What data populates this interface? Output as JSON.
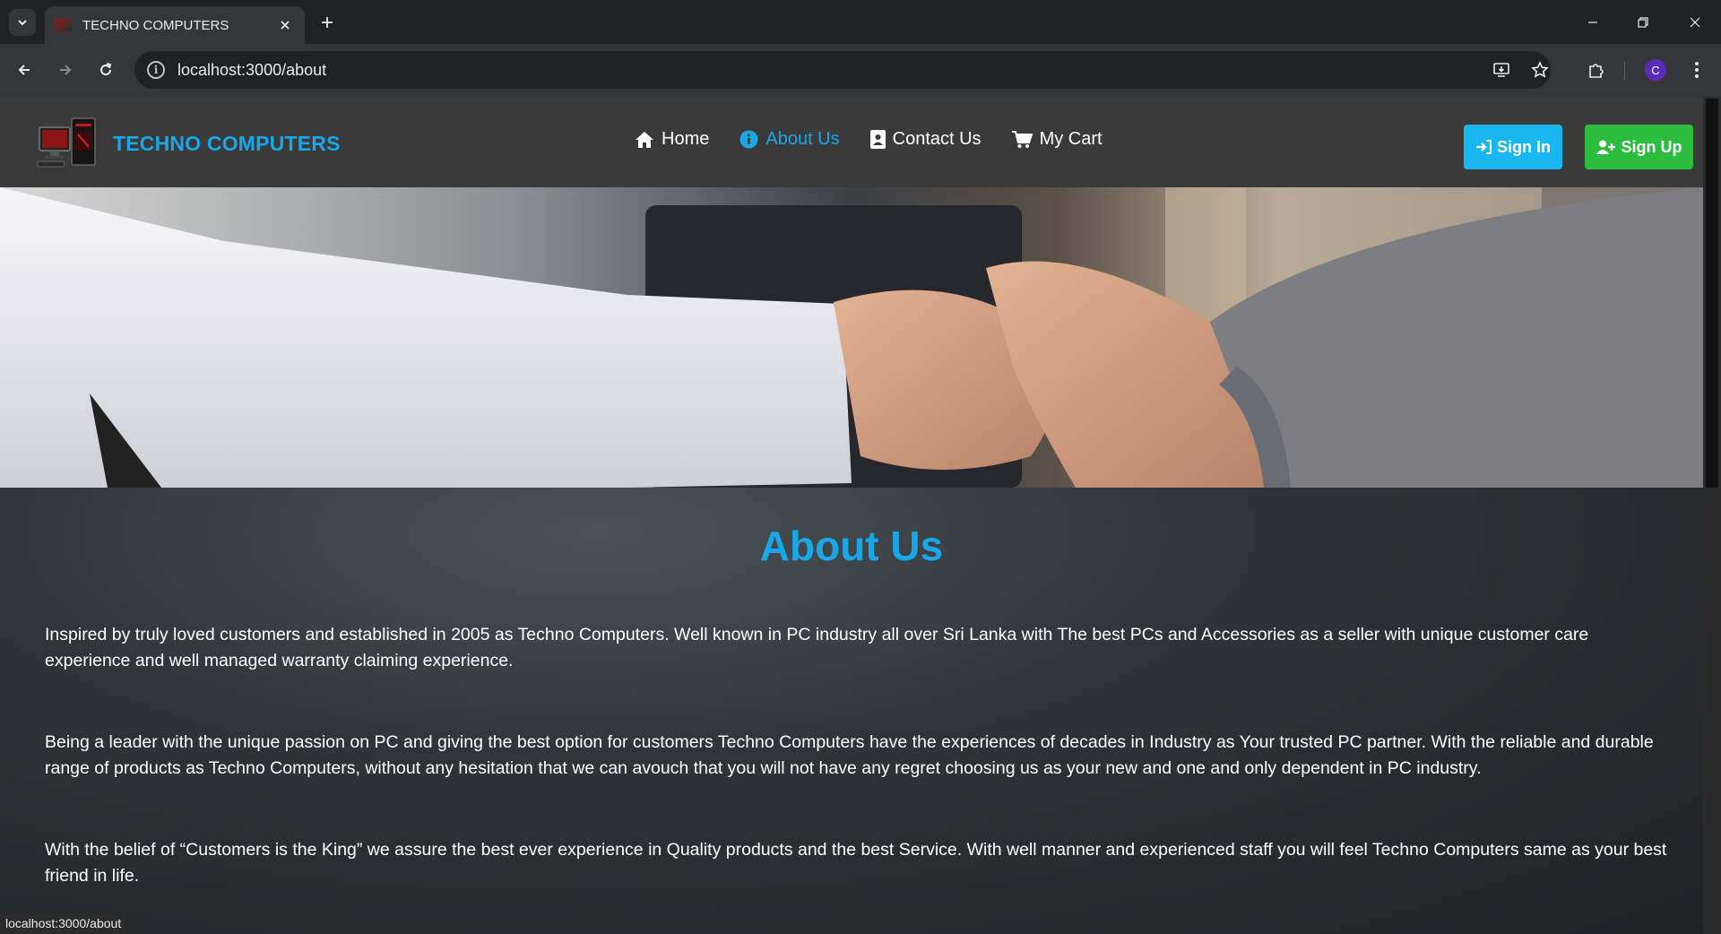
{
  "browser": {
    "tab_title": "TECHNO COMPUTERS",
    "url": "localhost:3000/about",
    "profile_initial": "C",
    "status_url": "localhost:3000/about"
  },
  "site": {
    "brand": "TECHNO COMPUTERS",
    "nav": [
      {
        "label": "Home",
        "icon": "home-icon"
      },
      {
        "label": "About Us",
        "icon": "info-icon",
        "active": true
      },
      {
        "label": "Contact Us",
        "icon": "contact-card-icon"
      },
      {
        "label": "My Cart",
        "icon": "cart-icon"
      }
    ],
    "sign_in": "Sign In",
    "sign_up": "Sign Up",
    "colors": {
      "accent": "#1aa7e8",
      "signin": "#1ab6f0",
      "signup": "#2dbd3e"
    }
  },
  "about": {
    "title": "About Us",
    "paragraphs": [
      "Inspired by truly loved customers and established in 2005 as Techno Computers. Well known in PC industry all over Sri Lanka with The best PCs and Accessories as a seller with unique customer care experience and well managed warranty claiming experience.",
      "Being a leader with the unique passion on PC and giving the best option for customers Techno Computers have the experiences of decades in Industry as Your trusted PC partner. With the reliable and durable range of products as Techno Computers, without any hesitation that we can avouch that you will not have any regret choosing us as your new and one and only dependent in PC industry.",
      "With the belief of “Customers is the King” we assure the best ever experience in Quality products and the best Service. With well manner and experienced staff you will feel Techno Computers same as your best friend in life."
    ]
  }
}
